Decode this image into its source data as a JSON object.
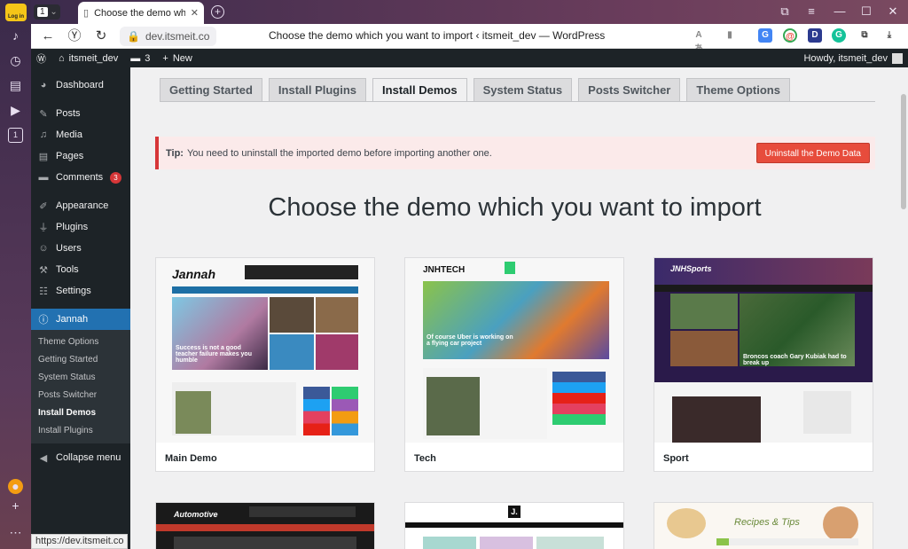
{
  "browser": {
    "login_label": "Log in",
    "tab_count": "1",
    "tab_title": "Choose the demo which y",
    "url": "dev.itsmeit.co",
    "page_title": "Choose the demo which you want to import ‹ itsmeit_dev — WordPress",
    "status_url": "https://dev.itsmeit.co"
  },
  "adminbar": {
    "site": "itsmeit_dev",
    "comments_count": "3",
    "new_label": "New",
    "howdy": "Howdy, itsmeit_dev"
  },
  "sidebar": {
    "items": [
      {
        "label": "Dashboard",
        "icon": "dashboard-icon"
      },
      {
        "label": "Posts",
        "icon": "pin-icon"
      },
      {
        "label": "Media",
        "icon": "media-icon"
      },
      {
        "label": "Pages",
        "icon": "page-icon"
      },
      {
        "label": "Comments",
        "icon": "comment-icon",
        "badge": "3"
      },
      {
        "label": "Appearance",
        "icon": "brush-icon"
      },
      {
        "label": "Plugins",
        "icon": "plug-icon"
      },
      {
        "label": "Users",
        "icon": "user-icon"
      },
      {
        "label": "Tools",
        "icon": "wrench-icon"
      },
      {
        "label": "Settings",
        "icon": "settings-icon"
      },
      {
        "label": "Jannah",
        "icon": "info-icon"
      }
    ],
    "submenu": [
      "Theme Options",
      "Getting Started",
      "System Status",
      "Posts Switcher",
      "Install Demos",
      "Install Plugins"
    ],
    "collapse": "Collapse menu"
  },
  "tabs": [
    "Getting Started",
    "Install Plugins",
    "Install Demos",
    "System Status",
    "Posts Switcher",
    "Theme Options"
  ],
  "tip": {
    "label": "Tip:",
    "text": "You need to uninstall the imported demo before importing another one.",
    "button": "Uninstall the Demo Data"
  },
  "heading": "Choose the demo which you want to import",
  "demos": [
    {
      "name": "Main Demo",
      "logo": "Jannah",
      "headline": "Success is not a good teacher failure makes you humble"
    },
    {
      "name": "Tech",
      "logo": "JNHTECH",
      "headline": "Of course Uber is working on a flying car project"
    },
    {
      "name": "Sport",
      "logo": "JNHSports",
      "headline": "Broncos coach Gary Kubiak had to break up"
    }
  ],
  "demos_row2": [
    {
      "logo": "Automotive"
    },
    {
      "logo": "J."
    },
    {
      "logo": "Recipes & Tips"
    }
  ],
  "colors": {
    "accent": "#2271b1",
    "admin_dark": "#1d2327",
    "danger": "#d63638"
  }
}
